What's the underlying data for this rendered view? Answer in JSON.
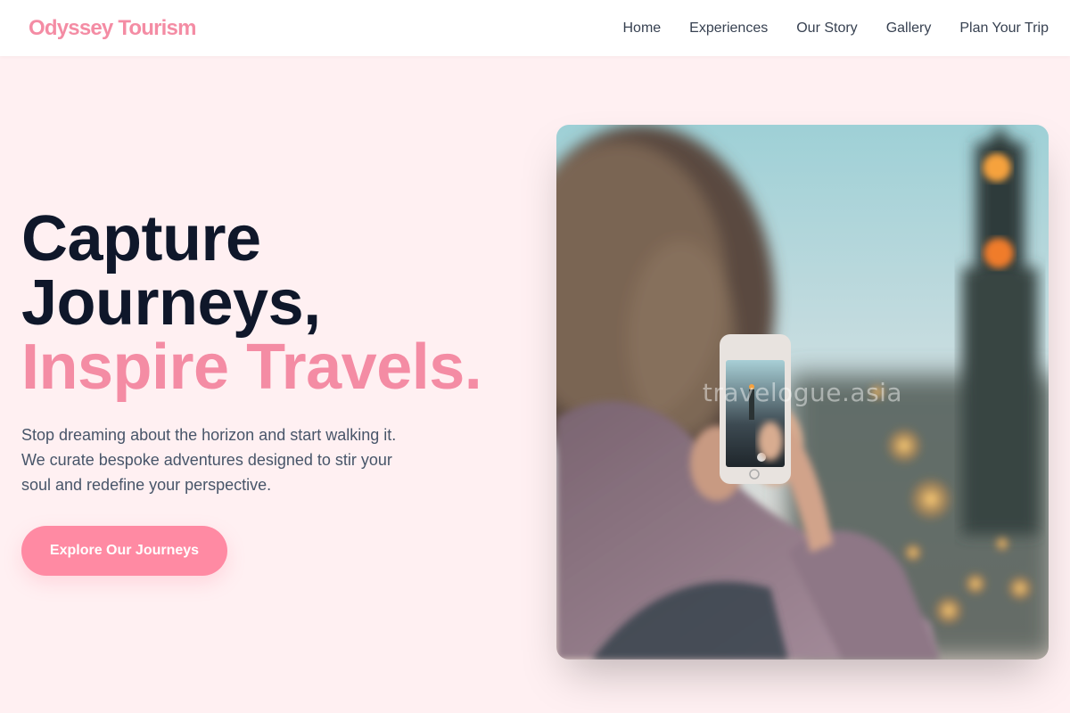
{
  "header": {
    "logo": "Odyssey Tourism",
    "nav": [
      "Home",
      "Experiences",
      "Our Story",
      "Gallery",
      "Plan Your Trip"
    ]
  },
  "hero": {
    "headline_line1": "Capture",
    "headline_line2": "Journeys,",
    "headline_accent": "Inspire Travels.",
    "subtext": "Stop dreaming about the horizon and start walking it. We curate bespoke adventures designed to stir your soul and redefine your perspective.",
    "cta_label": "Explore Our Journeys",
    "image_watermark": "travelogue.asia"
  },
  "colors": {
    "accent": "#f48ca4",
    "button": "#ff8aa3",
    "background": "#fff0f2",
    "heading": "#0f172a"
  }
}
